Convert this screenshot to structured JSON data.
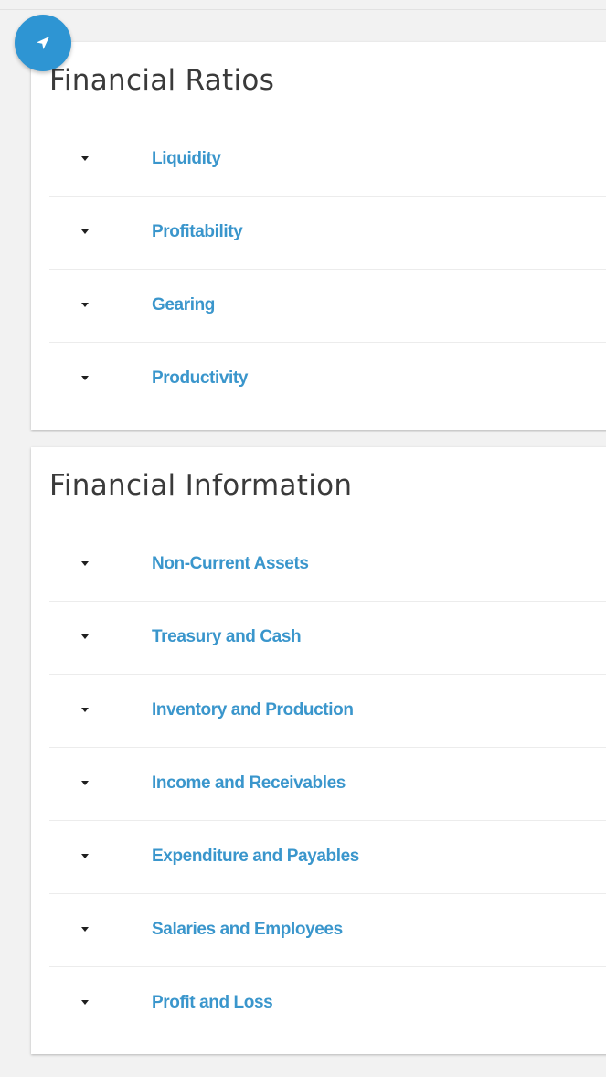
{
  "nav_badge": {
    "icon": "navigation-arrow-icon",
    "color": "#2e95d3"
  },
  "accent_color": "#3a96cc",
  "financial_ratios": {
    "title": "Financial Ratios",
    "items": [
      {
        "label": "Liquidity"
      },
      {
        "label": "Profitability"
      },
      {
        "label": "Gearing"
      },
      {
        "label": "Productivity"
      }
    ]
  },
  "financial_information": {
    "title": "Financial Information",
    "items": [
      {
        "label": "Non-Current Assets"
      },
      {
        "label": "Treasury and Cash"
      },
      {
        "label": "Inventory and Production"
      },
      {
        "label": "Income and Receivables"
      },
      {
        "label": "Expenditure and Payables"
      },
      {
        "label": "Salaries and Employees"
      },
      {
        "label": "Profit and Loss"
      }
    ]
  }
}
